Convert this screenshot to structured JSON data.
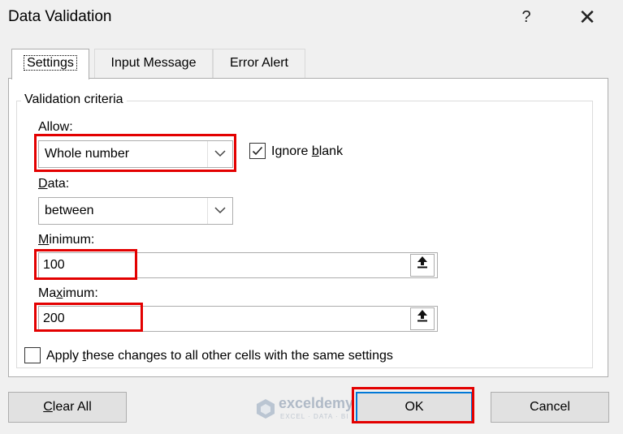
{
  "dialog": {
    "title": "Data Validation",
    "help_label": "?",
    "close_label": "✕"
  },
  "tabs": [
    {
      "label": "Settings",
      "active": true
    },
    {
      "label": "Input Message",
      "active": false
    },
    {
      "label": "Error Alert",
      "active": false
    }
  ],
  "criteria": {
    "group_label": "Validation criteria",
    "allow_label": "Allow:",
    "allow_value": "Whole number",
    "ignore_blank_pre": "Ignore ",
    "ignore_blank_key": "b",
    "ignore_blank_post": "lank",
    "ignore_blank_checked": true,
    "data_label_key": "D",
    "data_label_post": "ata:",
    "data_value": "between",
    "minimum_label_key": "M",
    "minimum_label_post": "inimum:",
    "minimum_value": "100",
    "maximum_label_pre": "Ma",
    "maximum_label_key": "x",
    "maximum_label_post": "imum:",
    "maximum_value": "200"
  },
  "apply_all": {
    "label_pre": "Apply ",
    "label_key": "t",
    "label_post": "hese changes to all other cells with the same settings",
    "checked": false
  },
  "buttons": {
    "clear_all_key": "C",
    "clear_all_post": "lear All",
    "ok": "OK",
    "cancel": "Cancel"
  },
  "watermark": {
    "name": "exceldemy",
    "sub": "EXCEL · DATA · BI"
  },
  "colors": {
    "highlight": "#e30000",
    "default_button_border": "#0078d7"
  }
}
